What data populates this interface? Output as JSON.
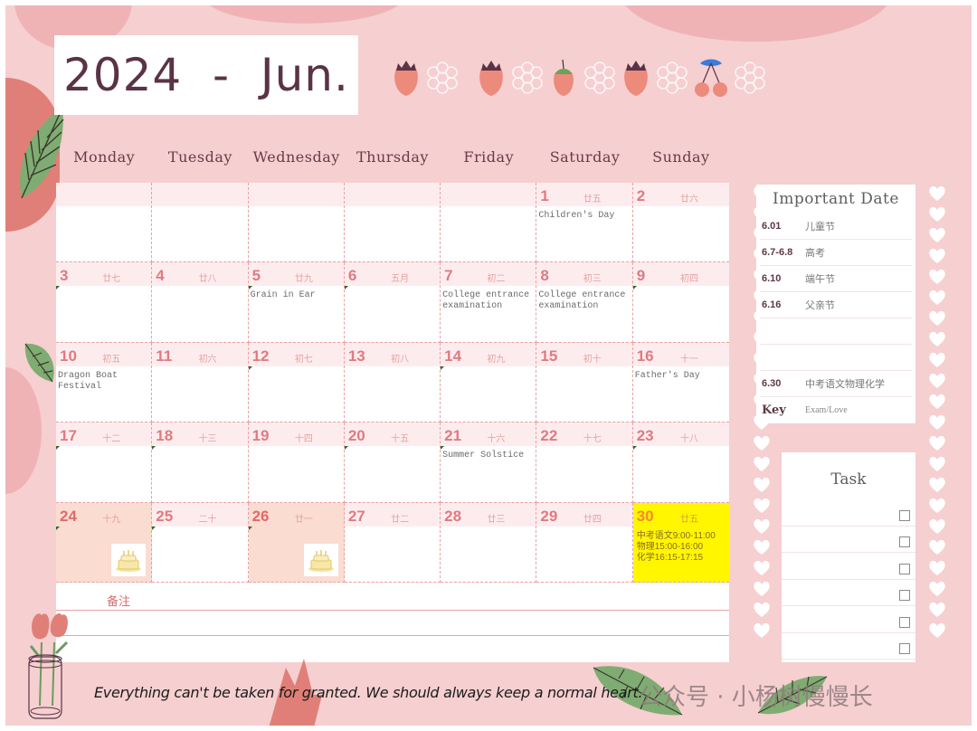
{
  "header": {
    "title": "2024  -  Jun."
  },
  "weekdays": [
    "Monday",
    "Tuesday",
    "Wednesday",
    "Thursday",
    "Friday",
    "Saturday",
    "Sunday"
  ],
  "calendar": {
    "cells": [
      {
        "day": "",
        "lunar": "",
        "event": ""
      },
      {
        "day": "",
        "lunar": "",
        "event": ""
      },
      {
        "day": "",
        "lunar": "",
        "event": ""
      },
      {
        "day": "",
        "lunar": "",
        "event": ""
      },
      {
        "day": "",
        "lunar": "",
        "event": ""
      },
      {
        "day": "1",
        "lunar": "廿五",
        "event": "Children's Day"
      },
      {
        "day": "2",
        "lunar": "廿六",
        "event": ""
      },
      {
        "day": "3",
        "lunar": "廿七",
        "event": ""
      },
      {
        "day": "4",
        "lunar": "廿八",
        "event": ""
      },
      {
        "day": "5",
        "lunar": "廿九",
        "event": "Grain in Ear"
      },
      {
        "day": "6",
        "lunar": "五月",
        "event": ""
      },
      {
        "day": "7",
        "lunar": "初二",
        "event": "College entrance examination"
      },
      {
        "day": "8",
        "lunar": "初三",
        "event": "College entrance examination"
      },
      {
        "day": "9",
        "lunar": "初四",
        "event": ""
      },
      {
        "day": "10",
        "lunar": "初五",
        "event": "Dragon Boat Festival"
      },
      {
        "day": "11",
        "lunar": "初六",
        "event": ""
      },
      {
        "day": "12",
        "lunar": "初七",
        "event": ""
      },
      {
        "day": "13",
        "lunar": "初八",
        "event": ""
      },
      {
        "day": "14",
        "lunar": "初九",
        "event": ""
      },
      {
        "day": "15",
        "lunar": "初十",
        "event": ""
      },
      {
        "day": "16",
        "lunar": "十一",
        "event": "Father's Day"
      },
      {
        "day": "17",
        "lunar": "十二",
        "event": ""
      },
      {
        "day": "18",
        "lunar": "十三",
        "event": ""
      },
      {
        "day": "19",
        "lunar": "十四",
        "event": ""
      },
      {
        "day": "20",
        "lunar": "十五",
        "event": ""
      },
      {
        "day": "21",
        "lunar": "十六",
        "event": "Summer Solstice"
      },
      {
        "day": "22",
        "lunar": "十七",
        "event": ""
      },
      {
        "day": "23",
        "lunar": "十八",
        "event": ""
      },
      {
        "day": "24",
        "lunar": "十九",
        "event": "",
        "style": "peach",
        "icon": "birthday-cake-icon"
      },
      {
        "day": "25",
        "lunar": "二十",
        "event": ""
      },
      {
        "day": "26",
        "lunar": "廿一",
        "event": "",
        "style": "peach",
        "icon": "birthday-cake-icon"
      },
      {
        "day": "27",
        "lunar": "廿二",
        "event": ""
      },
      {
        "day": "28",
        "lunar": "廿三",
        "event": ""
      },
      {
        "day": "29",
        "lunar": "廿四",
        "event": ""
      },
      {
        "day": "30",
        "lunar": "廿五",
        "event": "",
        "style": "yellow",
        "schedule": [
          "中考语文9:00-11:00",
          "物理15:00-16:00",
          "化学16:15-17:15"
        ]
      }
    ],
    "highlight_colors": {
      "peach": "#fbdcd0",
      "yellow": "#fff600"
    }
  },
  "notes": {
    "label": "备注"
  },
  "important_dates": {
    "title": "Important Date",
    "rows": [
      {
        "date": "6.01",
        "desc": "儿童节"
      },
      {
        "date": "6.7-6.8",
        "desc": "高考"
      },
      {
        "date": "6.10",
        "desc": "端午节"
      },
      {
        "date": "6.16",
        "desc": "父亲节"
      },
      {
        "date": "",
        "desc": ""
      },
      {
        "date": "",
        "desc": ""
      },
      {
        "date": "6.30",
        "desc": "中考语文物理化学"
      }
    ],
    "key_label": "Key",
    "key_desc": "Exam/Love"
  },
  "task": {
    "title": "Task",
    "items": [
      "",
      "",
      "",
      "",
      "",
      ""
    ]
  },
  "footer": {
    "quote": "Everything can't be taken for granted. We should always keep a normal heart.",
    "account_watermark": "公众号 · 小杨树慢慢长"
  },
  "decorations": {
    "header_icons": [
      "strawberry-icon",
      "flower-outline-icon",
      "strawberry-icon",
      "flower-outline-icon",
      "strawberry-green-icon",
      "flower-outline-icon",
      "strawberry-icon",
      "flower-outline-icon",
      "cherry-icon",
      "flower-outline-icon"
    ]
  },
  "colors": {
    "background": "#f6cfd0",
    "title_text": "#5a3346",
    "day_number": "#e07a80",
    "accent_red": "#e07f78",
    "leaf_green": "#7fac72"
  }
}
